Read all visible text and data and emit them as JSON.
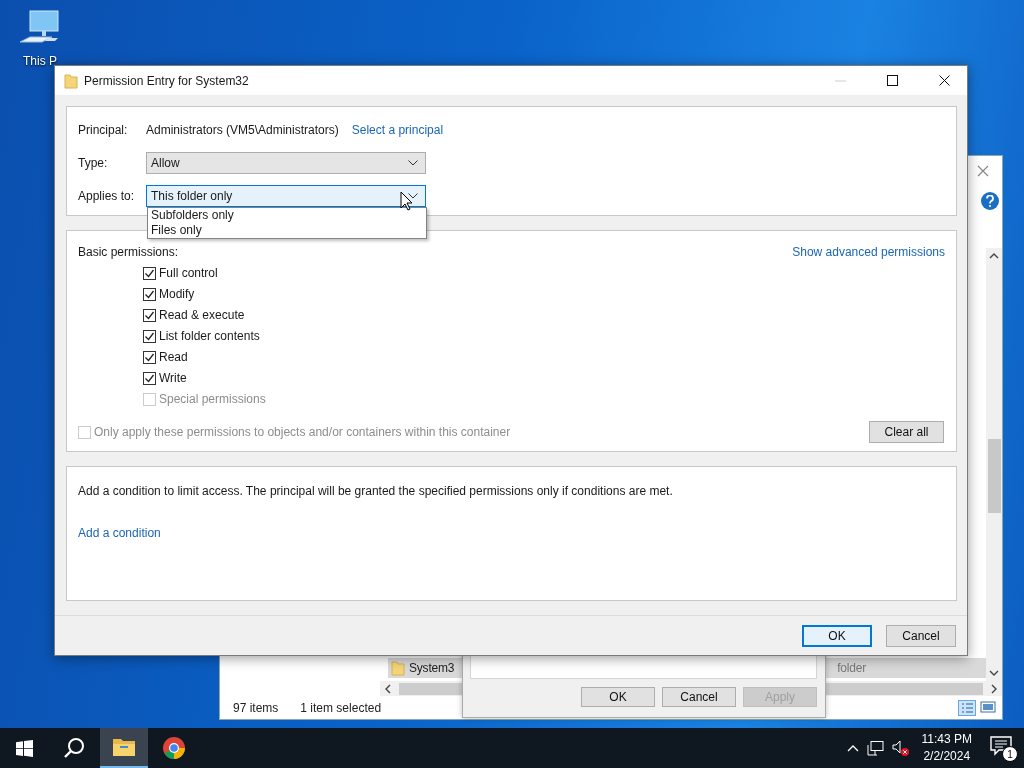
{
  "desktop": {
    "icons": [
      {
        "label": "This P"
      }
    ]
  },
  "explorer": {
    "items": [
      {
        "name": "System3",
        "type": "folder",
        "selected": true
      }
    ],
    "status": {
      "count": "97 items",
      "selection": "1 item selected"
    }
  },
  "properties_dialog": {
    "buttons": [
      {
        "label": "OK",
        "disabled": false
      },
      {
        "label": "Cancel",
        "disabled": false
      },
      {
        "label": "Apply",
        "disabled": true
      }
    ]
  },
  "permission_dialog": {
    "title": "Permission Entry for System32",
    "principal": {
      "label": "Principal:",
      "value": "Administrators (VM5\\Administrators)",
      "link": "Select a principal"
    },
    "type": {
      "label": "Type:",
      "value": "Allow"
    },
    "applies_to": {
      "label": "Applies to:",
      "value": "This folder only",
      "expanded": true,
      "options": [
        {
          "label": "Subfolders only",
          "selected": false
        },
        {
          "label": "Files only",
          "selected": false
        }
      ]
    },
    "basic_permissions": {
      "label": "Basic permissions:",
      "link": "Show advanced permissions",
      "items": [
        {
          "label": "Full control",
          "checked": true,
          "disabled": false
        },
        {
          "label": "Modify",
          "checked": true,
          "disabled": false
        },
        {
          "label": "Read & execute",
          "checked": true,
          "disabled": false
        },
        {
          "label": "List folder contents",
          "checked": true,
          "disabled": false
        },
        {
          "label": "Read",
          "checked": true,
          "disabled": false
        },
        {
          "label": "Write",
          "checked": true,
          "disabled": false
        },
        {
          "label": "Special permissions",
          "checked": false,
          "disabled": true
        }
      ]
    },
    "only_apply": {
      "label": "Only apply these permissions to objects and/or containers within this container",
      "checked": false,
      "disabled": true
    },
    "clear_all": "Clear all",
    "condition": {
      "text": "Add a condition to limit access. The principal will be granted the specified permissions only if conditions are met.",
      "link": "Add a condition"
    },
    "buttons": [
      {
        "label": "OK",
        "default": true
      },
      {
        "label": "Cancel",
        "default": false
      }
    ]
  },
  "taskbar": {
    "apps": [
      {
        "kind": "explorer",
        "active": true
      },
      {
        "kind": "browser",
        "active": false
      }
    ],
    "time": "11:43 PM",
    "date": "2/2/2024",
    "notifications": "1"
  }
}
